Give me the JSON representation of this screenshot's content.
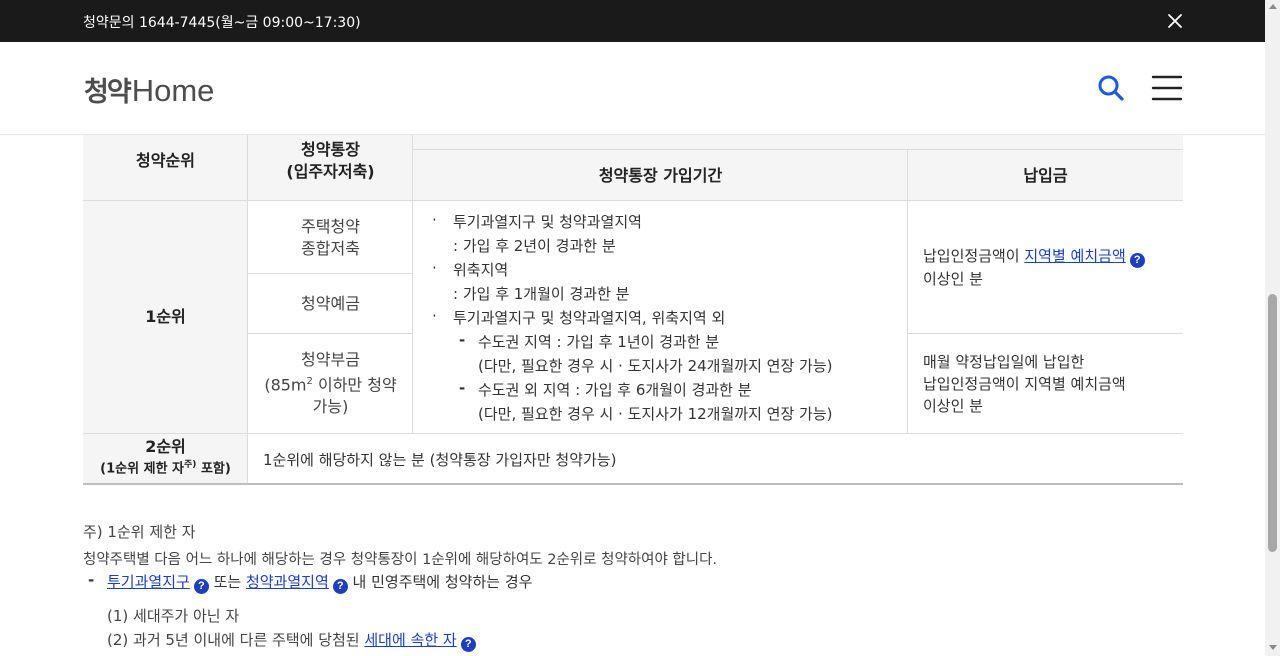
{
  "topbar": {
    "contact": "청약문의 1644-7445(월~금 09:00~17:30)"
  },
  "header": {
    "logo_ko": "청약",
    "logo_en": "Home"
  },
  "table": {
    "headers": {
      "rank": "청약순위",
      "account_line1": "청약통장",
      "account_line2": "(입주자저축)",
      "period": "청약통장 가입기간",
      "deposit": "납입금"
    },
    "rank1": {
      "label": "1순위",
      "account_types": [
        {
          "line1": "주택청약",
          "line2": "종합저축"
        },
        {
          "line1": "청약예금"
        },
        {
          "line1": "청약부금",
          "line2a": "(85m",
          "sup": "2",
          "line2b": " 이하만 청약",
          "line3": "가능)"
        }
      ],
      "period_items": [
        {
          "bullet": "·",
          "text": "투기과열지구 및 청약과열지역"
        },
        {
          "text": ": 가입 후 2년이 경과한 분"
        },
        {
          "bullet": "·",
          "text": "위축지역"
        },
        {
          "text": ": 가입 후 1개월이 경과한 분"
        },
        {
          "bullet": "·",
          "text": "투기과열지구 및 청약과열지역, 위축지역 외"
        },
        {
          "dash": "-",
          "text": "수도권 지역 : 가입 후 1년이 경과한 분"
        },
        {
          "text": "(다만, 필요한 경우 시 · 도지사가 24개월까지 연장 가능)"
        },
        {
          "dash": "-",
          "text": "수도권 외 지역 : 가입 후 6개월이 경과한 분"
        },
        {
          "text": "(다만, 필요한 경우 시 · 도지사가 12개월까지 연장 가능)"
        }
      ],
      "deposit_a": {
        "prefix": "납입인정금액이 ",
        "link": "지역별 예치금액",
        "suffix": "이상인 분"
      },
      "deposit_b": {
        "line1": "매월 약정납입일에 납입한",
        "line2": "납입인정금액이 지역별 예치금액",
        "line3": "이상인 분"
      }
    },
    "rank2": {
      "label": "2순위",
      "sub_a": "(1순위 제한 자",
      "sub_sup": "주)",
      "sub_b": " 포함)",
      "desc": "1순위에 해당하지 않는 분 (청약통장 가입자만 청약가능)"
    }
  },
  "note": {
    "title": "주) 1순위 제한 자",
    "desc": "청약주택별 다음 어느 하나에 해당하는 경우 청약통장이 1순위에 해당하여도 2순위로 청약하여야 합니다.",
    "bullet": {
      "dash": "-",
      "link1": "투기과열지구",
      "mid": " 또는 ",
      "link2": "청약과열지역",
      "suffix": " 내 민영주택에 청약하는 경우"
    },
    "items": [
      {
        "text": "(1) 세대주가 아닌 자"
      },
      {
        "text": "(2) 과거 5년 이내에 다른 주택에 당첨된 ",
        "link": "세대에 속한 자"
      }
    ]
  },
  "help_glyph": "?",
  "colors": {
    "topbar_bg": "#1a1a1a",
    "link": "#1d3fbb",
    "logo_accent": "#2a9df4",
    "icon_blue": "#1d5bd6",
    "header_cell_bg": "#f5f5f5"
  }
}
